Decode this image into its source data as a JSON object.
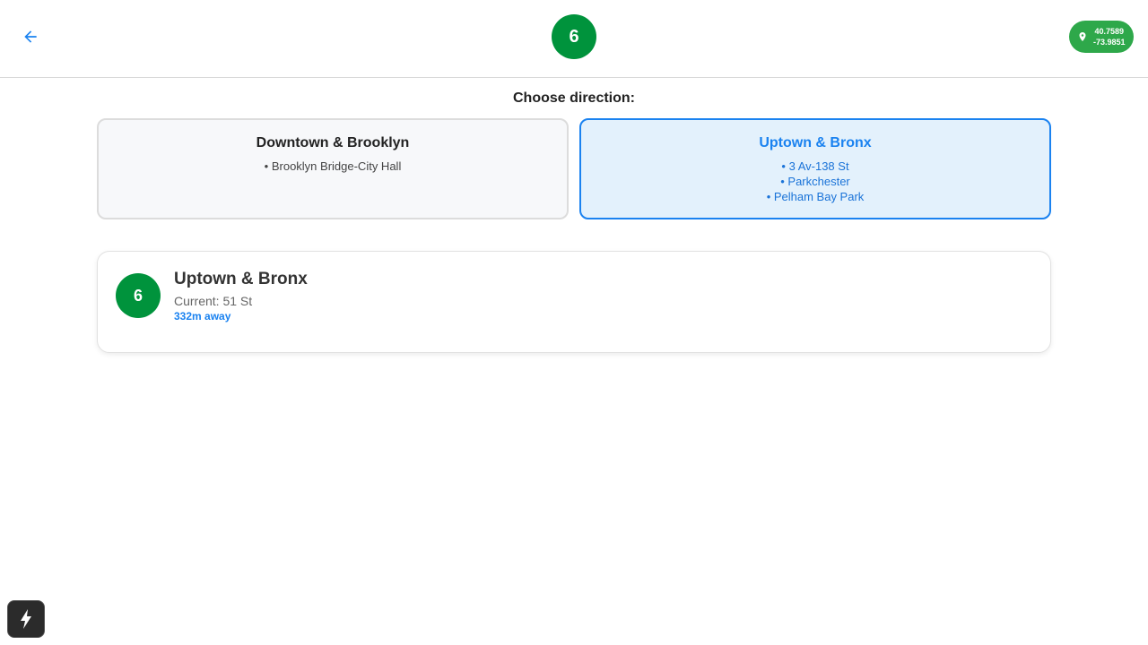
{
  "header": {
    "route": "6",
    "location": {
      "lat": "40.7589",
      "lon": "-73.9851"
    }
  },
  "direction": {
    "label": "Choose direction:",
    "options": [
      {
        "title": "Downtown & Brooklyn",
        "stops": [
          "• Brooklyn Bridge-City Hall"
        ],
        "selected": false
      },
      {
        "title": "Uptown & Bronx",
        "stops": [
          "• 3 Av-138 St",
          "• Parkchester",
          "• Pelham Bay Park"
        ],
        "selected": true
      }
    ]
  },
  "train": {
    "route": "6",
    "title": "Uptown & Bronx",
    "current": "Current: 51 St",
    "distance": "332m away"
  },
  "colors": {
    "route_green": "#00933c",
    "accent_blue": "#1a82f0",
    "location_green": "#2ea84a"
  },
  "icons": {
    "back": "arrow-left-icon",
    "location": "map-pin-icon",
    "quick_action": "lightning-icon"
  }
}
